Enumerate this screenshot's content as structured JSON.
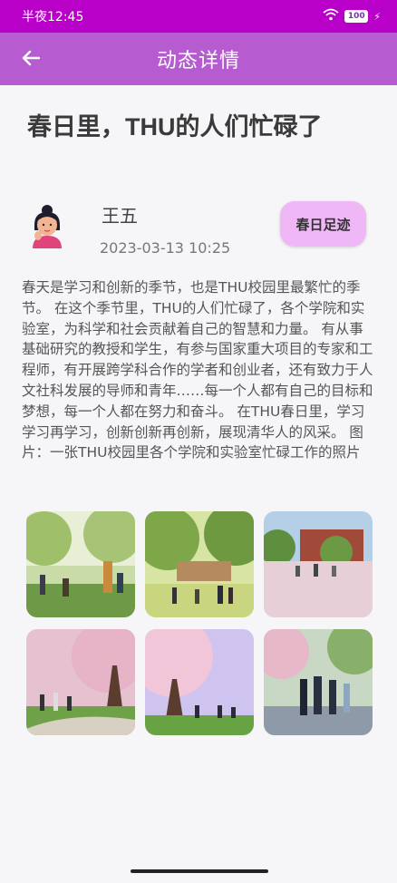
{
  "status_bar": {
    "time": "半夜12:45",
    "battery": "100",
    "wifi_icon": "wifi-icon",
    "charging_icon": "bolt-icon"
  },
  "app_bar": {
    "title": "动态详情",
    "back_icon": "arrow-left-icon"
  },
  "post": {
    "title": "春日里，THU的人们忙碌了",
    "author": {
      "name": "王五",
      "avatar_icon": "avatar-icon"
    },
    "timestamp": "2023-03-13 10:25",
    "tag_label": "春日足迹",
    "body": "春天是学习和创新的季节，也是THU校园里最繁忙的季节。 在这个季节里，THU的人们忙碌了，各个学院和实验室，为科学和社会贡献着自己的智慧和力量。 有从事基础研究的教授和学生，有参与国家重大项目的专家和工程师，有开展跨学科合作的学者和创业者，还有致力于人文社科发展的导师和青年……每一个人都有自己的目标和梦想，每一个人都在努力和奋斗。 在THU春日里，学习学习再学习，创新创新再创新，展现清华人的风采。 图片：一张THU校园里各个学院和实验室忙碌工作的照片",
    "photos": [
      {
        "name": "campus-photo-1"
      },
      {
        "name": "campus-photo-2"
      },
      {
        "name": "campus-photo-3"
      },
      {
        "name": "campus-photo-4"
      },
      {
        "name": "campus-photo-5"
      },
      {
        "name": "campus-photo-6"
      }
    ]
  },
  "colors": {
    "status_bar": "#b800c9",
    "app_bar": "#b75bd0",
    "tag_button": "#efb7f6",
    "background": "#f6f5f8"
  }
}
